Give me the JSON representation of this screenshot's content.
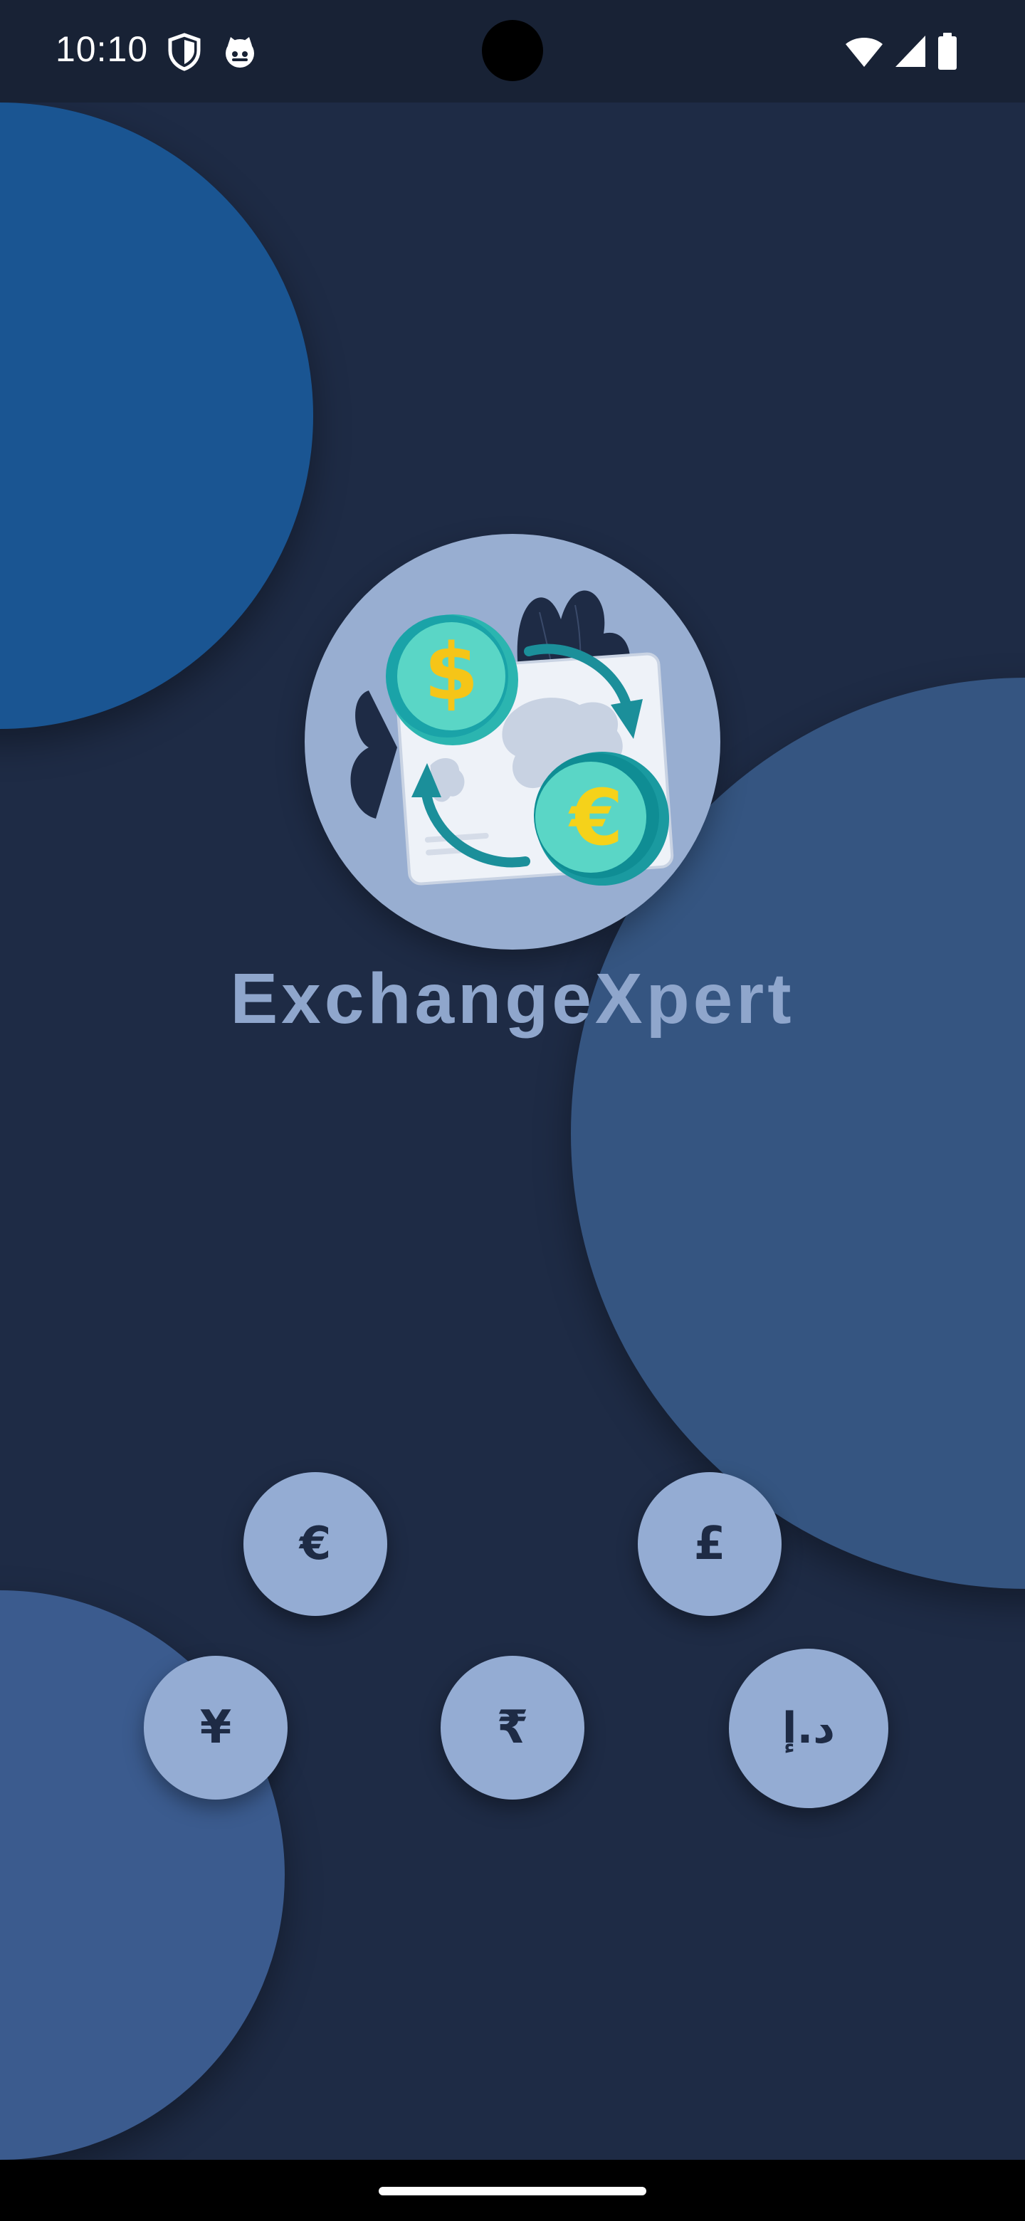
{
  "status_bar": {
    "time": "10:10",
    "left_icons": [
      "shield-icon",
      "cat-icon"
    ],
    "right_icons": [
      "wifi-icon",
      "cell-signal-icon",
      "battery-icon"
    ]
  },
  "app": {
    "title": "ExchangeXpert",
    "logo_icon": "currency-exchange-icon",
    "logo_coins": [
      "$",
      "€"
    ]
  },
  "currencies": [
    {
      "symbol": "€",
      "icon": "euro-icon"
    },
    {
      "symbol": "£",
      "icon": "pound-icon"
    },
    {
      "symbol": "¥",
      "icon": "yen-icon"
    },
    {
      "symbol": "₹",
      "icon": "rupee-icon"
    },
    {
      "symbol": "د.إ",
      "icon": "dirham-icon"
    }
  ],
  "colors": {
    "background": "#1e2b45",
    "status_bar": "#182235",
    "blob_primary": "#1a5592",
    "blob_secondary": "#355581",
    "blob_tertiary": "#3b5b8e",
    "accent_light": "#94acd3",
    "coin_teal": "#1aa3a8",
    "coin_gold": "#f5c518"
  }
}
